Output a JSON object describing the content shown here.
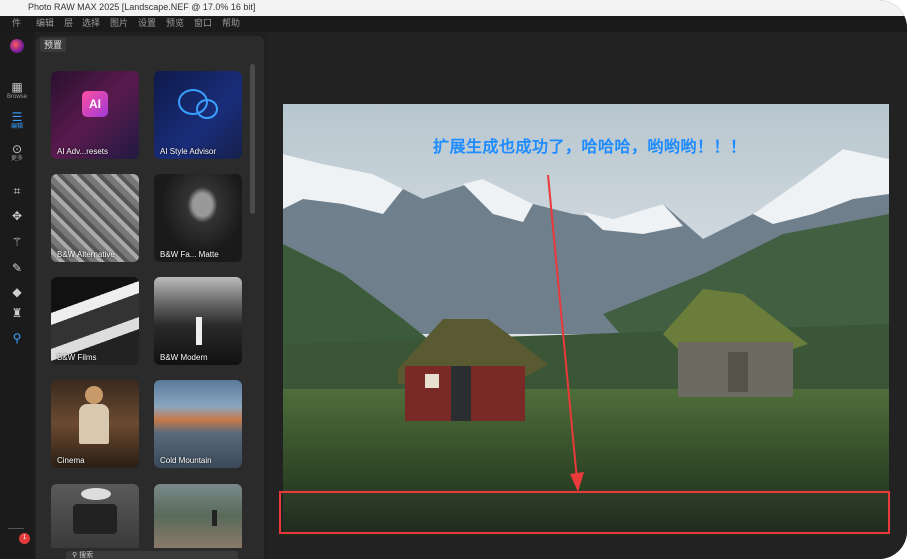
{
  "window": {
    "title": "Photo RAW MAX 2025 [Landscape.NEF @ 17.0% 16 bit]"
  },
  "menu": [
    "件",
    "编辑",
    "层",
    "选择",
    "图片",
    "设置",
    "预览",
    "窗口",
    "帮助"
  ],
  "rail": {
    "browse_label": "Browse",
    "edit_label": "编辑",
    "more_label": "更多",
    "notification_count": "1"
  },
  "panel": {
    "tab_label": "预置",
    "presets": [
      {
        "label": "AI Adv...resets",
        "thumb": "ai-chip"
      },
      {
        "label": "AI Style Advisor",
        "thumb": "ai-bubble"
      },
      {
        "label": "B&W Alternative",
        "thumb": "bw-architecture"
      },
      {
        "label": "B&W Fa... Matte",
        "thumb": "bw-portrait"
      },
      {
        "label": "B&W Films",
        "thumb": "bw-abstract"
      },
      {
        "label": "B&W Modern",
        "thumb": "bw-waterfall"
      },
      {
        "label": "Cinema",
        "thumb": "woman-seated"
      },
      {
        "label": "Cold Mountain",
        "thumb": "mountain-peaks"
      },
      {
        "label": "",
        "thumb": "kitchen-scale"
      },
      {
        "label": "",
        "thumb": "coastal-hiker"
      }
    ],
    "bottom_label": "搜索"
  },
  "canvas": {
    "annotation": "扩展生成也成功了，哈哈哈，哟哟哟！！！"
  },
  "colors": {
    "accent": "#3aa0ff",
    "annotation_blue": "#1e8cff",
    "annotation_red": "#e83a3a"
  }
}
